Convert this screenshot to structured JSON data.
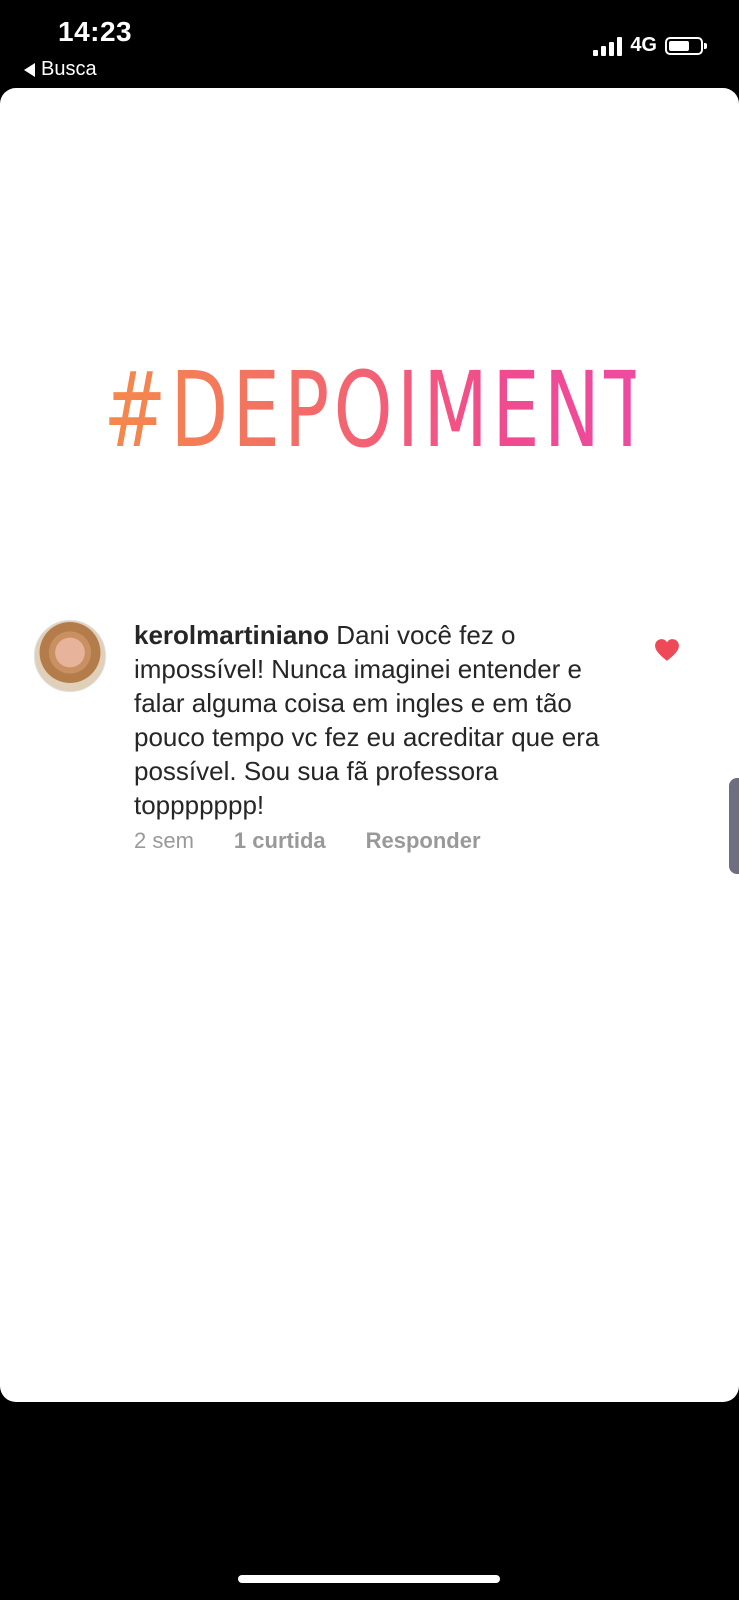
{
  "status_bar": {
    "time": "14:23",
    "back_label": "Busca",
    "network": "4G",
    "icons": [
      "signal-icon",
      "battery-icon",
      "back-arrow-icon"
    ]
  },
  "story": {
    "title": "#DEPOIMENTOS",
    "title_gradient": [
      "#f48a4a",
      "#f36a6a",
      "#f14b8f",
      "#ee4aa1"
    ],
    "comment": {
      "username": "kerolmartiniano",
      "text": "Dani você fez o impossível! Nunca imaginei entender e falar alguma coisa em ingles e em tão pouco tempo vc fez eu acreditar que era possível. Sou sua fã professora toppppppp!",
      "time_ago": "2 sem",
      "likes": "1 curtida",
      "reply_label": "Responder",
      "liked": true,
      "like_color": "#ed4956"
    }
  }
}
